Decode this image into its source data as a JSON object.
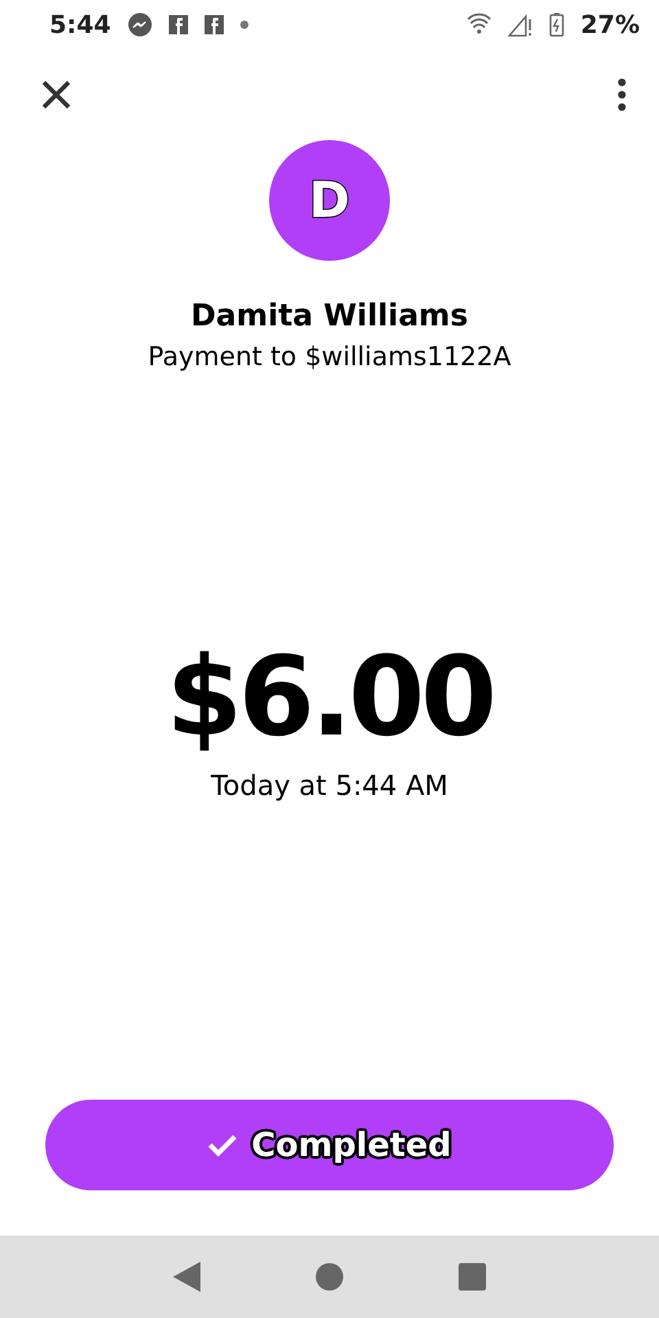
{
  "status_bar": {
    "time": "5:44",
    "battery": "27%"
  },
  "avatar": {
    "initial": "D"
  },
  "recipient": {
    "name": "Damita Williams",
    "subtitle": "Payment to $williams1122A"
  },
  "payment": {
    "amount": "$6.00",
    "date": "Today at 5:44 AM"
  },
  "status_button": {
    "label": "Completed"
  }
}
